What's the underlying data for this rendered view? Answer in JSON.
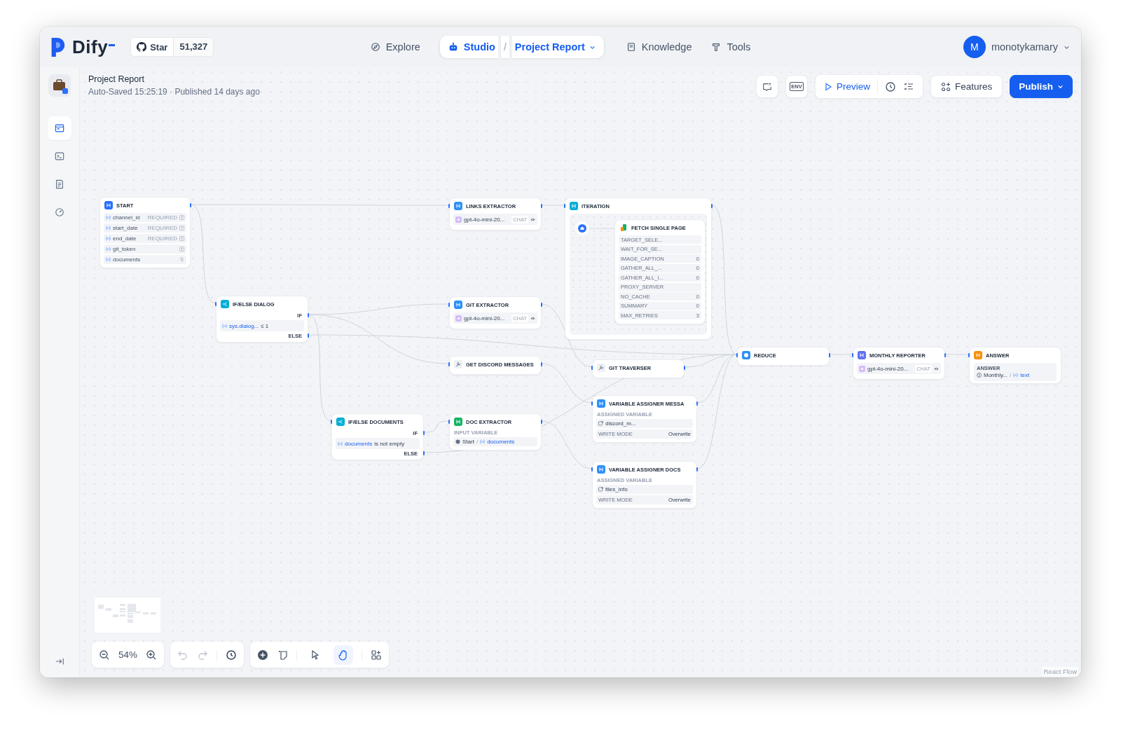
{
  "brand": {
    "name": "Dify"
  },
  "github": {
    "label": "Star",
    "count": "51,327"
  },
  "nav": [
    {
      "kind": "explore",
      "label": "Explore",
      "selected": false
    },
    {
      "kind": "studio",
      "label": "Studio",
      "separator": "/",
      "app": "Project Report",
      "selected": true
    },
    {
      "kind": "knowledge",
      "label": "Knowledge",
      "selected": false
    },
    {
      "kind": "tools",
      "label": "Tools",
      "selected": false
    }
  ],
  "user": {
    "initial": "M",
    "name": "monotykamary"
  },
  "sidebar": {
    "items": [
      {
        "kind": "orchestrate",
        "selected": true
      },
      {
        "kind": "api",
        "selected": false
      },
      {
        "kind": "logs",
        "selected": false
      },
      {
        "kind": "monitoring",
        "selected": false
      }
    ]
  },
  "project": {
    "title": "Project Report",
    "status": "Auto-Saved 15:25:19 · Published 14 days ago"
  },
  "actions": {
    "env": "ENV",
    "preview": "Preview",
    "features": "Features",
    "publish": "Publish"
  },
  "nodes": [
    {
      "kind": "start",
      "title": "START",
      "fields": [
        {
          "name": "channel_id",
          "tag": "REQUIRED",
          "kind": "text"
        },
        {
          "name": "start_date",
          "tag": "REQUIRED",
          "kind": "text"
        },
        {
          "name": "end_date",
          "tag": "REQUIRED",
          "kind": "text"
        },
        {
          "name": "git_token",
          "kind": "text"
        },
        {
          "name": "documents",
          "kind": "file"
        }
      ]
    },
    {
      "kind": "if_else",
      "title": "IF/ELSE DIALOG",
      "if_label": "IF",
      "variable": "sys.dialog...",
      "operator": "≤ 1",
      "else_label": "ELSE"
    },
    {
      "kind": "parameter_extractor",
      "title": "LINKS EXTRACTOR",
      "model": "gpt-4o-mini-20...",
      "mode": "CHAT"
    },
    {
      "kind": "iteration",
      "title": "ITERATION",
      "children": [
        {
          "kind": "tool",
          "title": "FETCH SINGLE PAGE",
          "params": [
            {
              "name": "TARGET_SELE..."
            },
            {
              "name": "WAIT_FOR_SE..."
            },
            {
              "name": "IMAGE_CAPTION",
              "value": "0"
            },
            {
              "name": "GATHER_ALL_...",
              "value": "0"
            },
            {
              "name": "GATHER_ALL_I...",
              "value": "0"
            },
            {
              "name": "PROXY_SERVER"
            },
            {
              "name": "NO_CACHE",
              "value": "0"
            },
            {
              "name": "SUMMARY",
              "value": "0"
            },
            {
              "name": "MAX_RETRIES",
              "value": "3"
            }
          ]
        }
      ]
    },
    {
      "kind": "parameter_extractor",
      "title": "GIT EXTRACTOR",
      "model": "gpt-4o-mini-20...",
      "mode": "CHAT"
    },
    {
      "kind": "tool",
      "title": "GET DISCORD MESSAGES"
    },
    {
      "kind": "tool",
      "title": "GIT TRAVERSER"
    },
    {
      "kind": "if_else",
      "title": "IF/ELSE DOCUMENTS",
      "if_label": "IF",
      "variable": "documents",
      "operator": "is not empty",
      "else_label": "ELSE"
    },
    {
      "kind": "document_extractor",
      "title": "DOC EXTRACTOR",
      "input_label": "INPUT VARIABLE",
      "source": "Start",
      "separator": "/",
      "variable": "documents"
    },
    {
      "kind": "variable_assigner",
      "title": "VARIABLE ASSIGNER MESSA",
      "assigned_label": "ASSIGNED VARIABLE",
      "variable": "discord_m...",
      "mode_label": "WRITE MODE",
      "mode": "Overwrite"
    },
    {
      "kind": "variable_assigner",
      "title": "VARIABLE ASSIGNER DOCS",
      "assigned_label": "ASSIGNED VARIABLE",
      "variable": "files_info",
      "mode_label": "WRITE MODE",
      "mode": "Overwrite"
    },
    {
      "kind": "code",
      "title": "REDUCE"
    },
    {
      "kind": "llm",
      "title": "MONTHLY REPORTER",
      "model": "gpt-4o-mini-20...",
      "mode": "CHAT"
    },
    {
      "kind": "answer",
      "title": "ANSWER",
      "answer_label": "ANSWER",
      "source": "Monthly...",
      "separator": "/",
      "variable": "text"
    }
  ],
  "controls": {
    "zoom": "54%",
    "undo_disabled": true,
    "redo_disabled": true,
    "modes": [
      {
        "kind": "pointer",
        "selected": false
      },
      {
        "kind": "hand",
        "selected": true
      }
    ]
  },
  "attribution": "React Flow"
}
